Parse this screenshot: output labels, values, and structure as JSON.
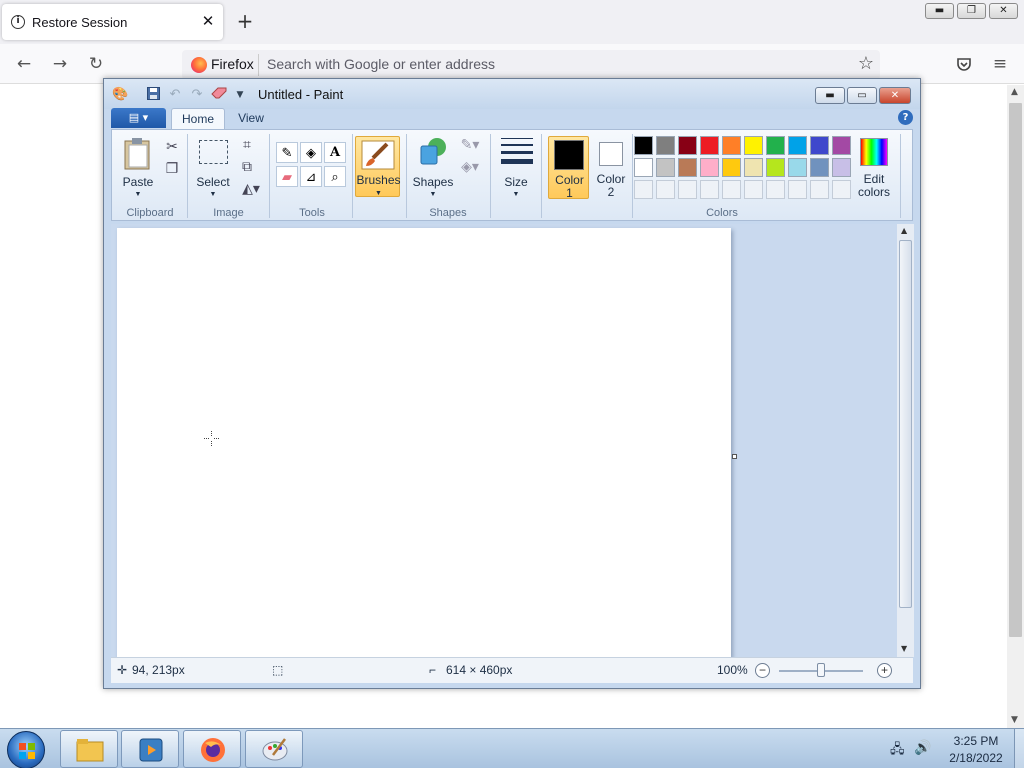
{
  "browser": {
    "tab_title": "Restore Session",
    "url_identity": "Firefox",
    "url_placeholder": "Search with Google or enter address"
  },
  "paint": {
    "window_title": "Untitled - Paint",
    "tabs": [
      "Home",
      "View"
    ],
    "groups": {
      "clipboard": "Clipboard",
      "image": "Image",
      "tools": "Tools",
      "shapes": "Shapes",
      "colors": "Colors"
    },
    "buttons": {
      "paste": "Paste",
      "select": "Select",
      "brushes": "Brushes",
      "shapes": "Shapes",
      "size": "Size",
      "color1_line1": "Color",
      "color1_line2": "1",
      "color2_line1": "Color",
      "color2_line2": "2",
      "edit_colors_line1": "Edit",
      "edit_colors_line2": "colors"
    },
    "palette_row1": [
      "#000000",
      "#7f7f7f",
      "#880015",
      "#ed1c24",
      "#ff7f27",
      "#fff200",
      "#22b14c",
      "#00a2e8",
      "#3f48cc",
      "#a349a4"
    ],
    "palette_row2": [
      "#ffffff",
      "#c3c3c3",
      "#b97a57",
      "#ffaec9",
      "#ffc90e",
      "#efe4b0",
      "#b5e61d",
      "#99d9ea",
      "#7092be",
      "#c8bfe7"
    ],
    "color1": "#000000",
    "color2": "#ffffff",
    "status": {
      "cursor_pos": "94, 213px",
      "canvas_size": "614 × 460px",
      "zoom": "100%"
    }
  },
  "taskbar": {
    "time": "3:25 PM",
    "date": "2/18/2022"
  }
}
